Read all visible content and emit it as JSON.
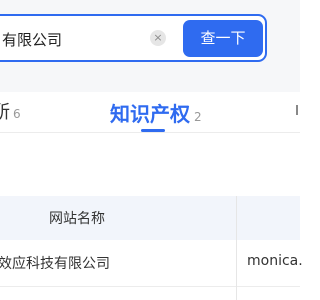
{
  "search": {
    "query": "有限公司",
    "clear_icon": "×",
    "button_label": "查一下"
  },
  "tabs": [
    {
      "label": "所",
      "count": "6"
    },
    {
      "label": "知识产权",
      "count": "2"
    }
  ],
  "table": {
    "headers": [
      "网站名称"
    ],
    "rows": [
      {
        "name": "效应科技有限公司",
        "url": "monica."
      }
    ]
  },
  "colors": {
    "accent": "#2f6bf0",
    "header_bg": "#f2f5fb",
    "top_bg": "#f6f7f9"
  }
}
